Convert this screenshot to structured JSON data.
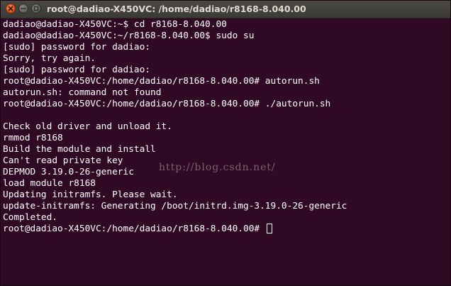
{
  "window": {
    "title": "root@dadiao-X450VC: /home/dadiao/r8168-8.040.00",
    "buttons": [
      "close-icon",
      "minimize-icon",
      "maximize-icon"
    ]
  },
  "terminal": {
    "lines": [
      "dadiao@dadiao-X450VC:~$ cd r8168-8.040.00",
      "dadiao@dadiao-X450VC:~/r8168-8.040.00$ sudo su",
      "[sudo] password for dadiao:",
      "Sorry, try again.",
      "[sudo] password for dadiao:",
      "root@dadiao-X450VC:/home/dadiao/r8168-8.040.00# autorun.sh",
      "autorun.sh: command not found",
      "root@dadiao-X450VC:/home/dadiao/r8168-8.040.00# ./autorun.sh",
      "",
      "Check old driver and unload it.",
      "rmmod r8168",
      "Build the module and install",
      "Can't read private key",
      "DEPMOD 3.19.0-26-generic",
      "load module r8168",
      "Updating initramfs. Please wait.",
      "update-initramfs: Generating /boot/initrd.img-3.19.0-26-generic",
      "Completed.",
      "root@dadiao-X450VC:/home/dadiao/r8168-8.040.00# "
    ],
    "watermark": "http://blog.csdn.net/",
    "colors": {
      "background": "#300a24",
      "foreground": "#ffffff",
      "close_button": "#e2531c"
    }
  }
}
